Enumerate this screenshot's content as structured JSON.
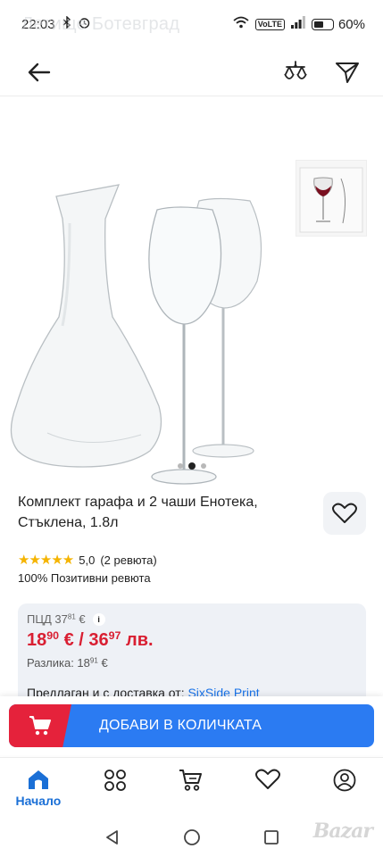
{
  "status": {
    "time": "22:03",
    "ghost_title": "Летище Ботевград",
    "volte": "VoLTE",
    "battery_percent": "60%",
    "battery_level": 0.6
  },
  "header": {
    "back_icon": "back-arrow-icon",
    "compare_icon": "scales-icon",
    "share_icon": "share-send-icon"
  },
  "gallery": {
    "dots": 3,
    "active_dot": 1
  },
  "product": {
    "title": "Комплект гарафа и 2 чаши Енотека, Стъклена, 1.8л",
    "rating": "5,0",
    "reviews": "(2 ревюта)",
    "stars": "★★★★★",
    "positive": "100% Позитивни ревюта"
  },
  "pricing": {
    "rrp_label": "ПЦД 37",
    "rrp_cents": "81",
    "rrp_currency": "€",
    "info_icon_text": "i",
    "price_eur": "18",
    "price_eur_cents": "90",
    "price_eur_sep": " € / ",
    "price_bgn": "36",
    "price_bgn_cents": "97",
    "price_bgn_sep": " лв.",
    "diff_label": "Разлика: 18",
    "diff_cents": "91",
    "diff_currency": " €",
    "seller_prefix": "Предлаган и с доставка от: ",
    "seller_name": "SixSide Print"
  },
  "cta": {
    "add_to_cart": "ДОБАВИ В КОЛИЧКАТА",
    "accent": "#2b7bf2",
    "icon_bg": "#e5223b"
  },
  "bottom_nav": {
    "home_label": "Начало"
  },
  "watermark": "Bazar"
}
